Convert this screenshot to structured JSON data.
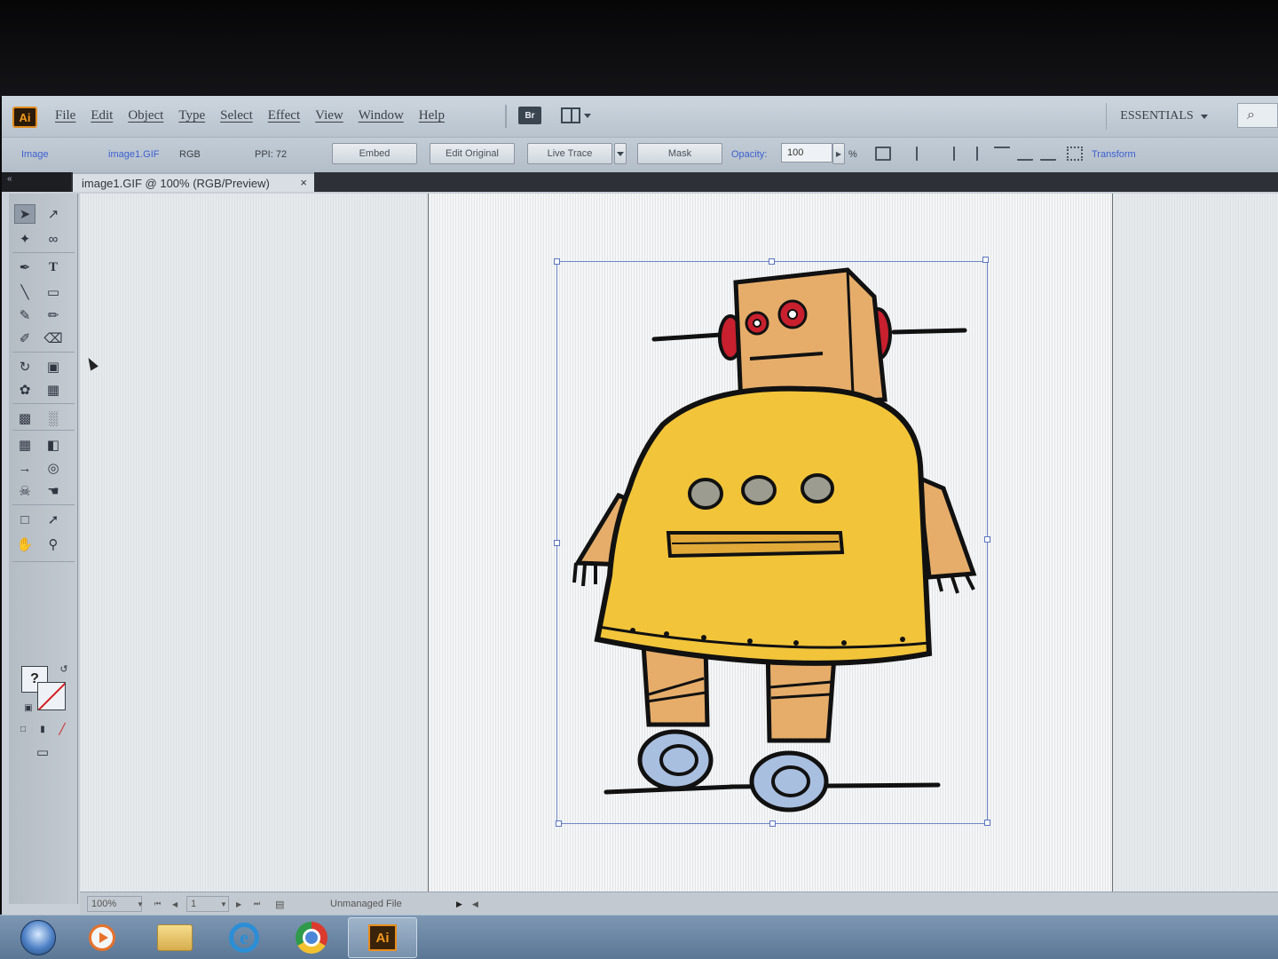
{
  "app": {
    "logo": "Ai",
    "menu": [
      "File",
      "Edit",
      "Object",
      "Type",
      "Select",
      "Effect",
      "View",
      "Window",
      "Help"
    ],
    "bridge_label": "Br",
    "workspace": "ESSENTIALS"
  },
  "control_bar": {
    "object_type": "Image",
    "file_name": "image1.GIF",
    "color_mode": "RGB",
    "ppi": "PPI: 72",
    "embed": "Embed",
    "edit_original": "Edit Original",
    "live_trace": "Live Trace",
    "mask": "Mask",
    "opacity_label": "Opacity:",
    "opacity_value": "100",
    "percent": "%",
    "transform": "Transform"
  },
  "document": {
    "tab_title": "image1.GIF @ 100% (RGB/Preview)",
    "close_glyph": "×"
  },
  "status_bar": {
    "zoom": "100%",
    "page": "1",
    "file_status": "Unmanaged File"
  },
  "taskbar": {
    "active_app": "Ai"
  },
  "colors": {
    "robot_body": "#f2c43a",
    "robot_head": "#e6ad6a",
    "robot_eyes": "#c8202e",
    "robot_wheels": "#a9bfe0",
    "selection": "#6f86c8"
  }
}
